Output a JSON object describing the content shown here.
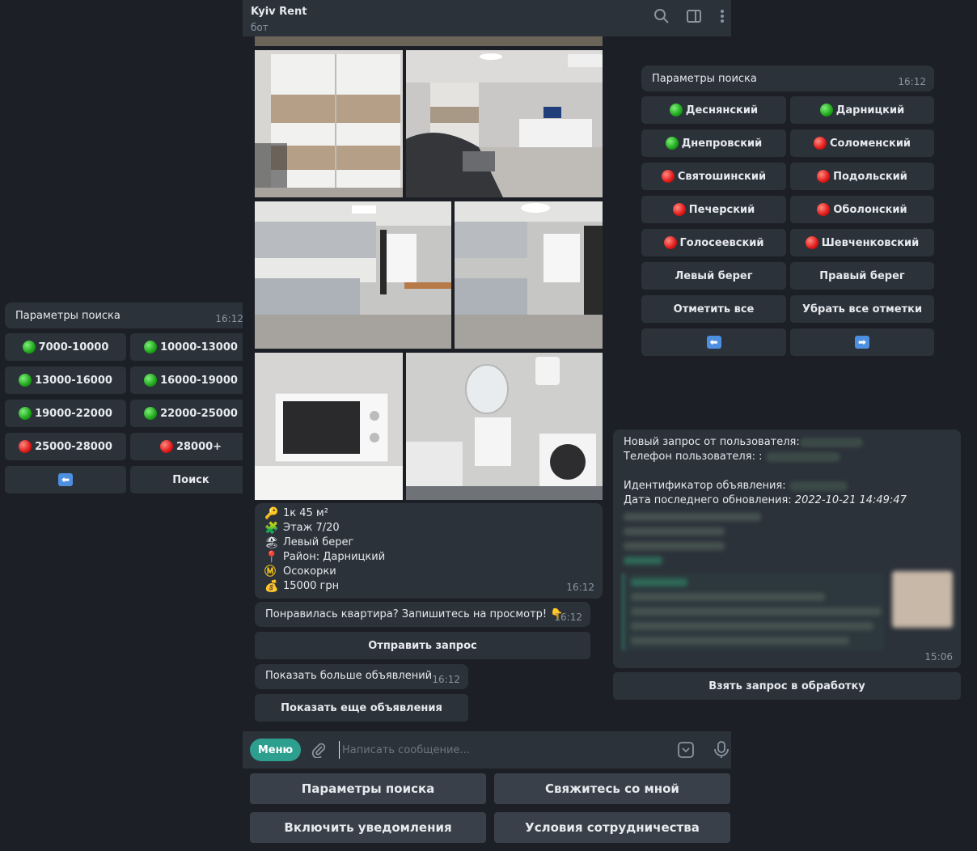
{
  "colors": {
    "bg": "#1c1f25",
    "bubble": "#2c323a",
    "accent": "#2c9f8e",
    "muted": "#8b949e"
  },
  "header": {
    "title": "Kyiv Rent",
    "subtitle": "бот",
    "icons": [
      "search-icon",
      "sidebar-toggle-icon",
      "more-vertical-icon"
    ]
  },
  "price_panel": {
    "title": "Параметры поиска",
    "time": "16:12",
    "buttons": [
      {
        "label": "7000-10000",
        "status": "green"
      },
      {
        "label": "10000-13000",
        "status": "green"
      },
      {
        "label": "13000-16000",
        "status": "green"
      },
      {
        "label": "16000-19000",
        "status": "green"
      },
      {
        "label": "19000-22000",
        "status": "green"
      },
      {
        "label": "22000-25000",
        "status": "green"
      },
      {
        "label": "25000-28000",
        "status": "red"
      },
      {
        "label": "28000+",
        "status": "red"
      }
    ],
    "back_icon": "left-arrow-icon",
    "search_label": "Поиск"
  },
  "district_panel": {
    "title": "Параметры поиска",
    "time": "16:12",
    "districts": [
      {
        "label": "Деснянский",
        "status": "green"
      },
      {
        "label": "Дарницкий",
        "status": "green"
      },
      {
        "label": "Днепровский",
        "status": "green"
      },
      {
        "label": "Соломенский",
        "status": "red"
      },
      {
        "label": "Святошинский",
        "status": "red"
      },
      {
        "label": "Подольский",
        "status": "red"
      },
      {
        "label": "Печерский",
        "status": "red"
      },
      {
        "label": "Оболонский",
        "status": "red"
      },
      {
        "label": "Голосеевский",
        "status": "red"
      },
      {
        "label": "Шевченковский",
        "status": "red"
      }
    ],
    "left_bank": "Левый берег",
    "right_bank": "Правый берег",
    "select_all": "Отметить все",
    "clear_all": "Убрать все отметки",
    "back_icon": "left-arrow-icon",
    "next_icon": "right-arrow-icon"
  },
  "listing": {
    "lines": [
      {
        "icon": "🔑",
        "text": "1к  45 м²"
      },
      {
        "icon": "🧩",
        "text": "Этаж 7/20"
      },
      {
        "icon": "🏖",
        "text": "Левый берег"
      },
      {
        "icon": "📍",
        "text": "Район: Дарницкий"
      },
      {
        "icon": "Ⓜ",
        "text": "Осокорки"
      },
      {
        "icon": "💰",
        "text": "15000  грн"
      }
    ],
    "time": "16:12"
  },
  "cta": {
    "text": "Понравилась квартира? Запишитесь на просмотр! 👇",
    "time": "16:12",
    "button": "Отправить запрос"
  },
  "more": {
    "text": "Показать больше объявлений",
    "time": "16:12",
    "button": "Показать еще объявления"
  },
  "request": {
    "line1": "Новый запрос от пользователя:",
    "line2": "Телефон пользователя: :",
    "line3": "Идентификатор объявления:",
    "line4_label": "Дата последнего обновления:",
    "line4_value": "2022-10-21 14:49:47",
    "time": "15:06",
    "button": "Взять запрос в обработку"
  },
  "composer": {
    "menu_label": "Меню",
    "placeholder": "Написать сообщение..."
  },
  "reply_keyboard": [
    "Параметры поиска",
    "Свяжитесь со мной",
    "Включить уведомления",
    "Условия сотрудничества"
  ]
}
